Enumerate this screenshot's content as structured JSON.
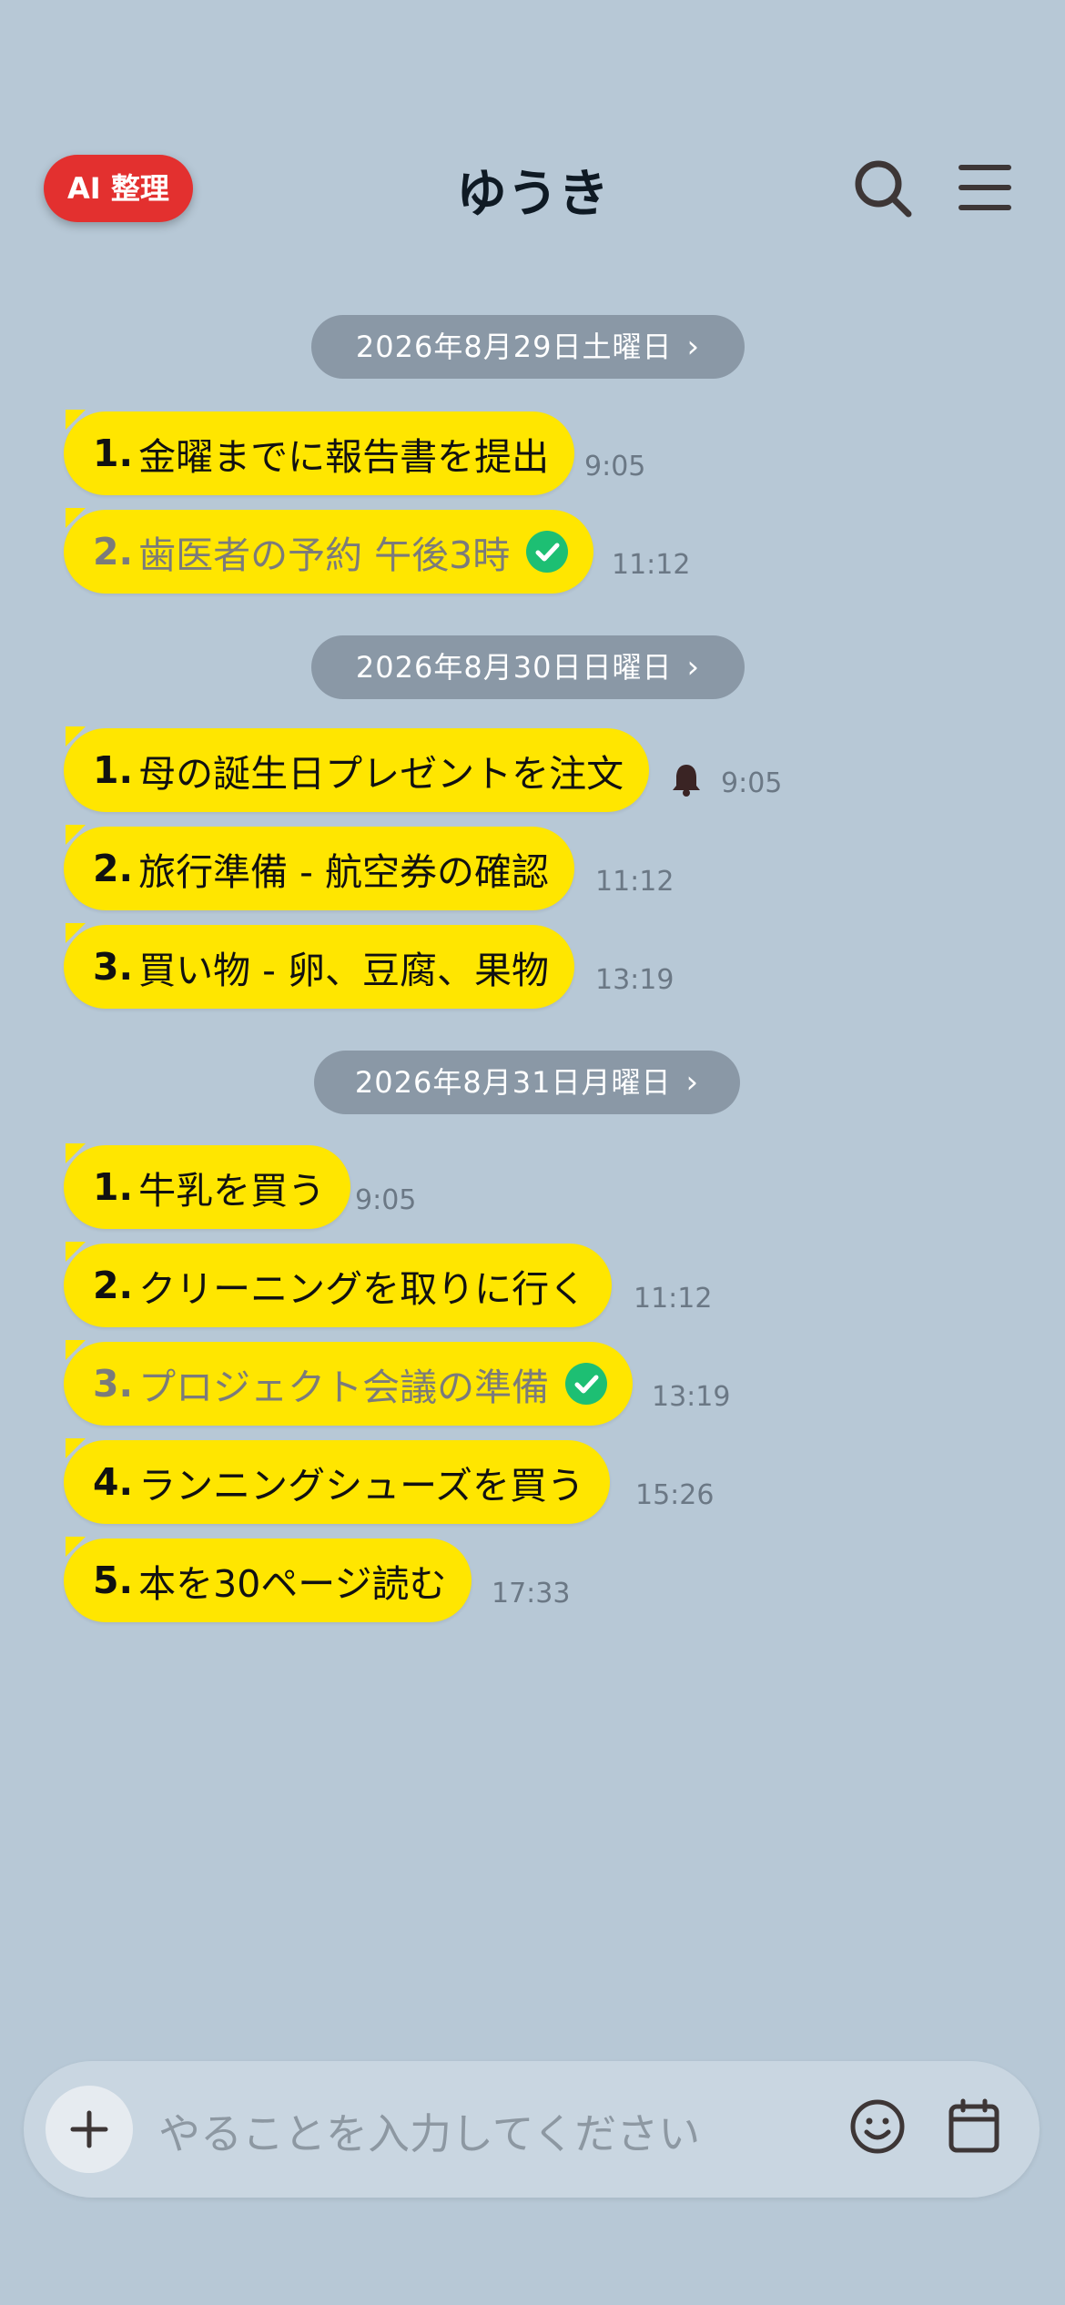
{
  "header": {
    "ai_button": "AI 整理",
    "title": "ゆうき"
  },
  "days": [
    {
      "date": "2026年8月29日土曜日",
      "items": [
        {
          "num": "1.",
          "text": "金曜までに報告書を提出",
          "time": "9:05",
          "done": false
        },
        {
          "num": "2.",
          "text": "歯医者の予約 午後3時",
          "time": "11:12",
          "done": true
        }
      ]
    },
    {
      "date": "2026年8月30日日曜日",
      "items": [
        {
          "num": "1.",
          "text": "母の誕生日プレゼントを注文",
          "time": "9:05",
          "done": false,
          "reminder": true
        },
        {
          "num": "2.",
          "text": "旅行準備 - 航空券の確認",
          "time": "11:12",
          "done": false
        },
        {
          "num": "3.",
          "text": "買い物 - 卵、豆腐、果物",
          "time": "13:19",
          "done": false
        }
      ]
    },
    {
      "date": "2026年8月31日月曜日",
      "items": [
        {
          "num": "1.",
          "text": "牛乳を買う",
          "time": "9:05",
          "done": false
        },
        {
          "num": "2.",
          "text": "クリーニングを取りに行く",
          "time": "11:12",
          "done": false
        },
        {
          "num": "3.",
          "text": "プロジェクト会議の準備",
          "time": "13:19",
          "done": true
        },
        {
          "num": "4.",
          "text": "ランニングシューズを買う",
          "time": "15:26",
          "done": false
        },
        {
          "num": "5.",
          "text": "本を30ページ読む",
          "time": "17:33",
          "done": false
        }
      ]
    }
  ],
  "input": {
    "placeholder": "やることを入力してください"
  },
  "icons": {
    "search": "search-icon",
    "menu": "menu-icon",
    "plus": "plus-icon",
    "emoji": "smiley-icon",
    "calendar": "calendar-icon",
    "check": "check-circle-icon",
    "bell": "bell-icon",
    "chevron": "chevron-right-icon"
  },
  "colors": {
    "background": "#b7c8d6",
    "bubble": "#ffe600",
    "ai_button": "#e3302f",
    "check": "#1dbf73",
    "date_chip": "#8a98a6"
  }
}
